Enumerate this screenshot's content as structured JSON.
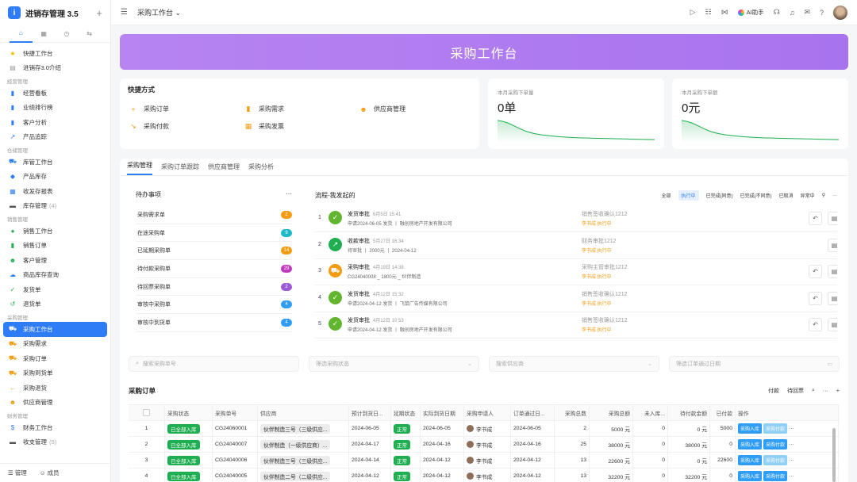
{
  "app": {
    "name": "进销存管理 3.5",
    "logo": "i"
  },
  "sidebar": {
    "tabs": [
      "home-icon",
      "grid-icon",
      "clock-icon",
      "flow-icon"
    ],
    "items": [
      {
        "type": "item",
        "icon": "★",
        "label": "快捷工作台",
        "color": "#f5b400"
      },
      {
        "type": "item",
        "icon": "▤",
        "label": "进销存3.0介绍",
        "color": "#999"
      },
      {
        "type": "group",
        "label": "经营管理"
      },
      {
        "type": "item",
        "icon": "▮",
        "label": "经营看板",
        "color": "#2f7df6"
      },
      {
        "type": "item",
        "icon": "▮",
        "label": "业绩排行榜",
        "color": "#2f7df6"
      },
      {
        "type": "item",
        "icon": "▮",
        "label": "客户分析",
        "color": "#2f7df6"
      },
      {
        "type": "item",
        "icon": "↗",
        "label": "产品追踪",
        "color": "#2f7df6"
      },
      {
        "type": "group",
        "label": "仓储管理"
      },
      {
        "type": "item",
        "icon": "⛟",
        "label": "库管工作台",
        "color": "#2f7df6"
      },
      {
        "type": "item",
        "icon": "◆",
        "label": "产品库存",
        "color": "#2f7df6"
      },
      {
        "type": "item",
        "icon": "▦",
        "label": "收发存报表",
        "color": "#2f7df6"
      },
      {
        "type": "item",
        "icon": "▬",
        "label": "库存管理",
        "count": "(4)",
        "color": "#555"
      },
      {
        "type": "group",
        "label": "销售管理"
      },
      {
        "type": "item",
        "icon": "●",
        "label": "销售工作台",
        "color": "#1fae50"
      },
      {
        "type": "item",
        "icon": "▮",
        "label": "销售订单",
        "color": "#1fae50"
      },
      {
        "type": "item",
        "icon": "☻",
        "label": "客户管理",
        "color": "#1fae50"
      },
      {
        "type": "item",
        "icon": "☁",
        "label": "商品库存查询",
        "color": "#2f7df6"
      },
      {
        "type": "item",
        "icon": "✓",
        "label": "发货单",
        "color": "#1fae50"
      },
      {
        "type": "item",
        "icon": "↺",
        "label": "退货单",
        "color": "#1fae50"
      },
      {
        "type": "group",
        "label": "采购管理"
      },
      {
        "type": "item",
        "icon": "⛟",
        "label": "采购工作台",
        "color": "#fff",
        "active": true
      },
      {
        "type": "item",
        "icon": "⛟",
        "label": "采购需求",
        "color": "#f39c12"
      },
      {
        "type": "item",
        "icon": "⛟",
        "label": "采购订单",
        "color": "#f39c12"
      },
      {
        "type": "item",
        "icon": "⛟",
        "label": "采购到货单",
        "color": "#f39c12"
      },
      {
        "type": "item",
        "icon": "←",
        "label": "采购退货",
        "color": "#f39c12"
      },
      {
        "type": "item",
        "icon": "☻",
        "label": "供应商管理",
        "color": "#f39c12"
      },
      {
        "type": "group",
        "label": "财务管理"
      },
      {
        "type": "item",
        "icon": "$",
        "label": "财务工作台",
        "color": "#2f7df6"
      },
      {
        "type": "item",
        "icon": "▬",
        "label": "收支管理",
        "count": "(5)",
        "color": "#555"
      }
    ],
    "footer": {
      "manage": "管理",
      "members": "成员"
    }
  },
  "topbar": {
    "title": "采购工作台",
    "ai": "AI助手"
  },
  "banner": {
    "title": "采购工作台"
  },
  "quick": {
    "title": "快捷方式",
    "items": [
      {
        "icon": "+",
        "label": "采购订单"
      },
      {
        "icon": "▮",
        "label": "采购需求"
      },
      {
        "icon": "☻",
        "label": "供应商管理"
      },
      {
        "icon": "↘",
        "label": "采购付款"
      },
      {
        "icon": "▦",
        "label": "采购发票"
      }
    ]
  },
  "stats": [
    {
      "label": "本月采购下单量",
      "value": "0单"
    },
    {
      "label": "本月采购下单额",
      "value": "0元"
    }
  ],
  "tabs": [
    "采购管理",
    "采购订单跟踪",
    "供应商管理",
    "采购分析"
  ],
  "todo": {
    "title": "待办事项",
    "more": "···",
    "items": [
      {
        "label": "采购需求单",
        "count": "2",
        "color": "#f39c12"
      },
      {
        "label": "在途采购单",
        "count": "9",
        "color": "#1fb8c9"
      },
      {
        "label": "已延期采购单",
        "count": "14",
        "color": "#f39c12"
      },
      {
        "label": "待付款采购单",
        "count": "29",
        "color": "#c03bbb"
      },
      {
        "label": "待回票采购单",
        "count": "2",
        "color": "#9b59d6"
      },
      {
        "label": "审核中采购单",
        "count": "4",
        "color": "#2f9df6"
      },
      {
        "label": "审核中到货单",
        "count": "4",
        "color": "#2f9df6"
      }
    ]
  },
  "flow": {
    "title": "流程-我发起的",
    "filters": [
      "全部",
      "执行中",
      "已完成(同意)",
      "已完成(不同意)",
      "已取消",
      "异常中"
    ],
    "active_filter": "执行中",
    "rows": [
      {
        "num": "1",
        "icon": "✓",
        "color": "#62b52e",
        "title": "发货审批",
        "time": "6月5日 15:41",
        "desc": "申请2024-06-05 发货 丨 融创房地产开发有限公司",
        "node": "销售签收确认1212",
        "status": "李书成 执行中",
        "buttons": 2
      },
      {
        "num": "2",
        "icon": "↗",
        "color": "#1fae50",
        "title": "收款审批",
        "time": "5月27日 16:34",
        "desc": "待审批 丨 2000元 丨 2024-04-12",
        "node": "财务审批1212",
        "status": "李书成 执行中",
        "buttons": 1
      },
      {
        "num": "3",
        "icon": "⛟",
        "color": "#f39c12",
        "title": "采购审批",
        "time": "4月19日 14:38",
        "desc": "CG24040008 _ 1800元 _ 伙伴制造",
        "node": "采购主管审批1212",
        "status": "李书成 执行中",
        "buttons": 2
      },
      {
        "num": "4",
        "icon": "✓",
        "color": "#62b52e",
        "title": "发货审批",
        "time": "4月12日 15:32",
        "desc": "申请2024-04-12 发货 丨 飞鼠广告传媒有限公司",
        "node": "销售签收确认1212",
        "status": "李书成 执行中",
        "buttons": 2
      },
      {
        "num": "5",
        "icon": "✓",
        "color": "#62b52e",
        "title": "发货审批",
        "time": "4月12日 10:53",
        "desc": "申请2024-04-12 发货 丨 融创房地产开发有限公司",
        "node": "销售签收确认1212",
        "status": "李书成 执行中",
        "buttons": 2
      }
    ]
  },
  "search": {
    "p1": "搜索采购单号",
    "p2": "筛选采购状态",
    "p3": "搜索供应商",
    "p4": "筛选订单通过日期"
  },
  "table": {
    "title": "采购订单",
    "actions": [
      "付款",
      "待回票"
    ],
    "headers": [
      "",
      "采购状态",
      "采购单号",
      "供应商",
      "预计到货日...",
      "延期状态",
      "实际到货日期",
      "采购申请人",
      "订单通过日...",
      "采购总数",
      "采购总额",
      "未入库...",
      "待付款金额",
      "已付款",
      "操作"
    ],
    "rows": [
      {
        "idx": "1",
        "status": "已全部入库",
        "no": "CG24060001",
        "supplier": "伙伴制造三号（三级供应...",
        "eta": "2024-06-05",
        "delay": "正常",
        "actual": "2024-06-05",
        "applicant": "李书成",
        "pass": "2024-06-05",
        "qty": "2",
        "amount": "5000 元",
        "pending": "0",
        "topay": "0 元",
        "paid": "5000"
      },
      {
        "idx": "2",
        "status": "已全部入库",
        "no": "CG24040007",
        "supplier": "伙伴制造（一级供应商）...",
        "eta": "2024-04-17",
        "delay": "正常",
        "actual": "2024-04-16",
        "applicant": "李书成",
        "pass": "2024-04-16",
        "qty": "25",
        "amount": "38000 元",
        "pending": "0",
        "topay": "38000 元",
        "paid": "0"
      },
      {
        "idx": "3",
        "status": "已全部入库",
        "no": "CG24040006",
        "supplier": "伙伴制造三号（三级供应...",
        "eta": "2024-04-14",
        "delay": "正常",
        "actual": "2024-04-12",
        "applicant": "李书成",
        "pass": "2024-04-12",
        "qty": "13",
        "amount": "22600 元",
        "pending": "0",
        "topay": "0 元",
        "paid": "22600"
      },
      {
        "idx": "4",
        "status": "已全部入库",
        "no": "CG24040005",
        "supplier": "伙伴制造二号（二级供应...",
        "eta": "2024-04-12",
        "delay": "正常",
        "actual": "2024-04-12",
        "applicant": "李书成",
        "pass": "2024-04-12",
        "qty": "13",
        "amount": "32200 元",
        "pending": "0",
        "topay": "32200 元",
        "paid": "0"
      }
    ],
    "op1": "采购入库",
    "op2": "采购付款"
  }
}
